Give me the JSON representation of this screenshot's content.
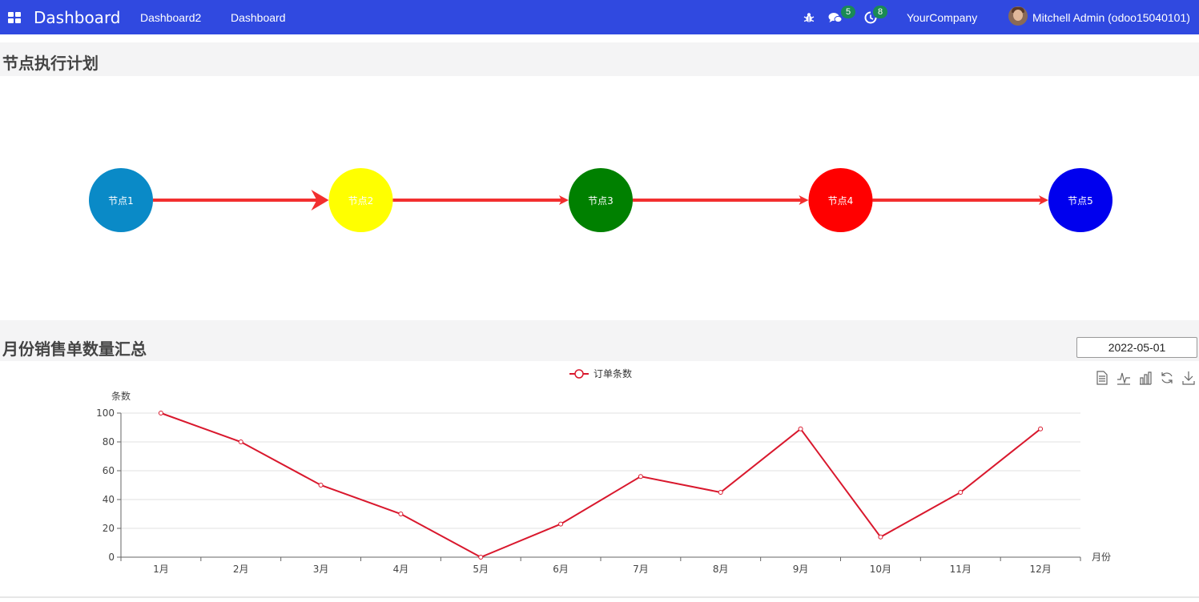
{
  "navbar": {
    "brand": "Dashboard",
    "menu": [
      "Dashboard2",
      "Dashboard"
    ],
    "chat_badge": "5",
    "activity_badge": "8",
    "company": "YourCompany",
    "user": "Mitchell Admin (odoo15040101)",
    "icons": [
      "apps-icon",
      "bug-icon",
      "chat-icon",
      "activity-icon"
    ]
  },
  "flow": {
    "title": "节点执行计划",
    "nodes": [
      {
        "label": "节点1",
        "color": "#0a8ac7"
      },
      {
        "label": "节点2",
        "color": "#ffff00"
      },
      {
        "label": "节点3",
        "color": "#008000"
      },
      {
        "label": "节点4",
        "color": "#ff0000"
      },
      {
        "label": "节点5",
        "color": "#0000ee"
      }
    ],
    "edge_color": "#f22f2f"
  },
  "sales": {
    "title": "月份销售单数量汇总",
    "date": "2022-05-01"
  },
  "chart_data": {
    "type": "line",
    "categories": [
      "1月",
      "2月",
      "3月",
      "4月",
      "5月",
      "6月",
      "7月",
      "8月",
      "9月",
      "10月",
      "11月",
      "12月"
    ],
    "series": [
      {
        "name": "订单条数",
        "values": [
          100,
          80,
          50,
          30,
          0,
          23,
          56,
          45,
          89,
          14,
          45,
          89
        ],
        "color": "#d9182d"
      }
    ],
    "ylabel": "条数",
    "xlabel": "月份",
    "ylim": [
      0,
      100
    ],
    "yticks": [
      0,
      20,
      40,
      60,
      80,
      100
    ],
    "legend": "top-center",
    "grid": true,
    "toolbox": [
      "data-view-icon",
      "line-chart-icon",
      "bar-chart-icon",
      "restore-icon",
      "download-icon"
    ]
  }
}
